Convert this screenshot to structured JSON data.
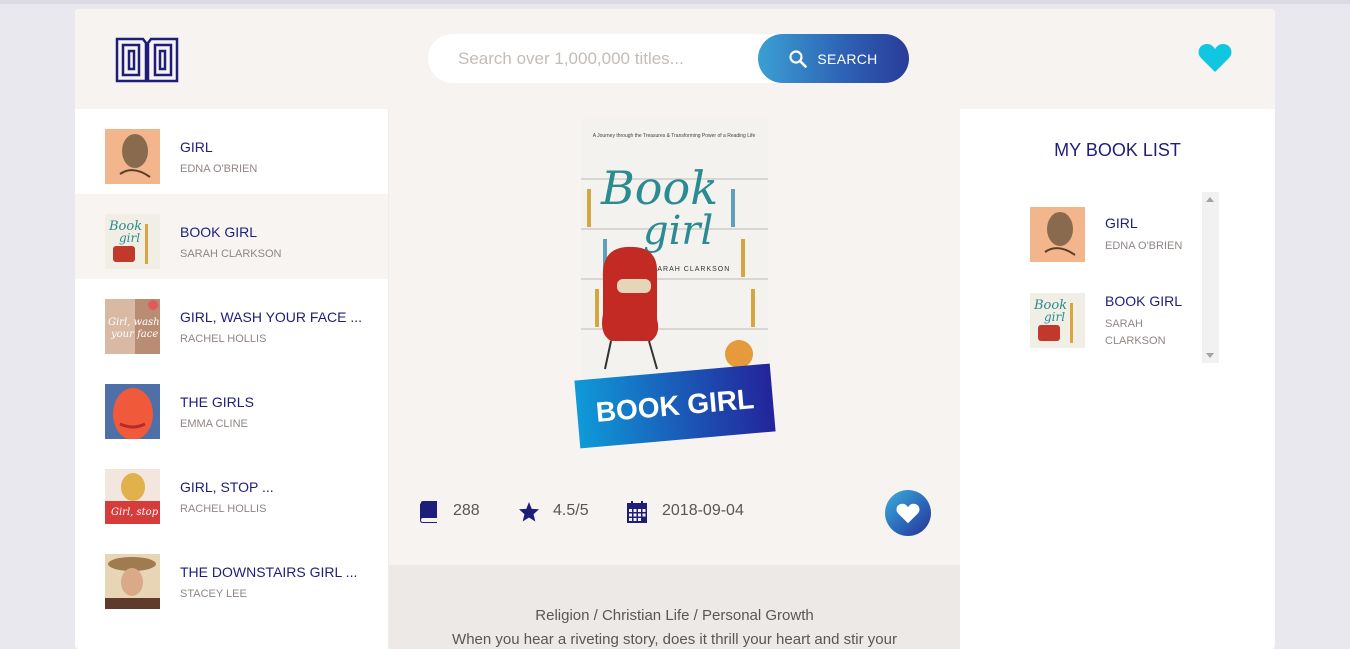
{
  "header": {
    "logo_icon": "open-book-logo-icon",
    "search_placeholder": "Search over 1,000,000 titles...",
    "search_button_label": "SEARCH",
    "favorites_icon": "heart-icon",
    "accent_color": "#00bcd4"
  },
  "results": [
    {
      "title": "GIRL",
      "author": "EDNA O'BRIEN",
      "active": false
    },
    {
      "title": "BOOK GIRL",
      "author": "SARAH CLARKSON",
      "active": true
    },
    {
      "title": "GIRL, WASH YOUR FACE ...",
      "author": "RACHEL HOLLIS",
      "active": false
    },
    {
      "title": "THE GIRLS",
      "author": "EMMA CLINE",
      "active": false
    },
    {
      "title": "GIRL, STOP ...",
      "author": "RACHEL HOLLIS",
      "active": false
    },
    {
      "title": "THE DOWNSTAIRS GIRL ...",
      "author": "STACEY LEE",
      "active": false
    }
  ],
  "detail": {
    "title": "BOOK GIRL",
    "cover": {
      "title_line1": "Book",
      "title_line2": "girl",
      "author": "SARAH CLARKSON",
      "tagline": "A Journey through the Treasures & Transforming Power of a Reading Life"
    },
    "pages": "288",
    "rating": "4.5/5",
    "published": "2018-09-04",
    "genre": "Religion / Christian Life / Personal Growth",
    "description_start": "When you hear a riveting story, does it thrill your heart and stir your"
  },
  "mylist": {
    "title": "MY BOOK LIST",
    "items": [
      {
        "title": "GIRL",
        "author": "EDNA O'BRIEN"
      },
      {
        "title": "BOOK GIRL",
        "author": "SARAH CLARKSON"
      }
    ]
  }
}
